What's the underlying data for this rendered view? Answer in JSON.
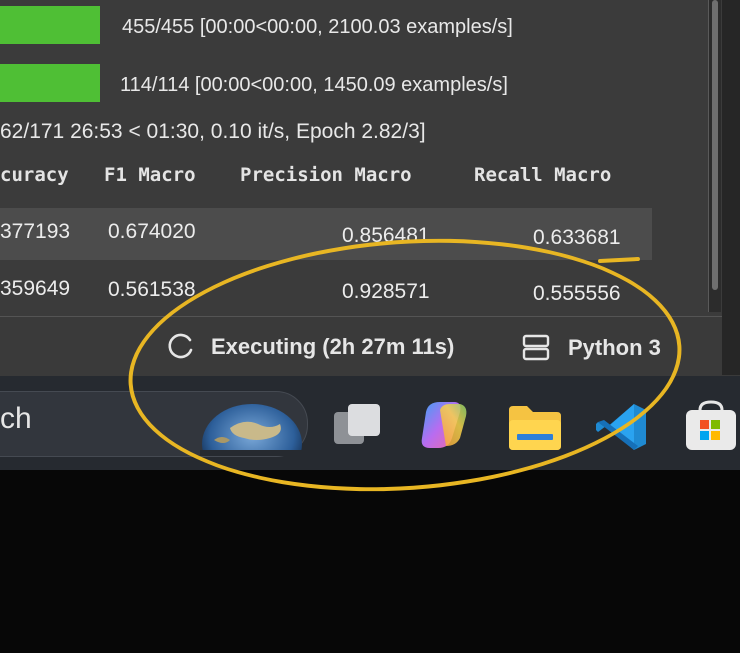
{
  "notebook": {
    "progress_rows": [
      {
        "text": "455/455  [00:00<00:00,  2100.03  examples/s]"
      },
      {
        "text": "114/114  [00:00<00:00,  1450.09  examples/s]"
      }
    ],
    "training_progress": "62/171 26:53 < 01:30, 0.10 it/s, Epoch 2.82/3]",
    "table": {
      "columns": [
        "curacy",
        "F1 Macro",
        "Precision Macro",
        "Recall Macro"
      ],
      "rows": [
        [
          "377193",
          "0.674020",
          "0.856481",
          "0.633681"
        ],
        [
          "359649",
          "0.561538",
          "0.928571",
          "0.555556"
        ]
      ]
    }
  },
  "statusbar": {
    "executing_label": "Executing (2h 27m 11s)",
    "kernel_label": "Python 3",
    "spinner_icon": "loading-spinner-icon",
    "kernel_icon": "kernel-status-icon"
  },
  "taskbar": {
    "search_text": "ch",
    "apps": [
      {
        "name": "earth-widget-icon"
      },
      {
        "name": "task-view-icon"
      },
      {
        "name": "copilot-icon"
      },
      {
        "name": "file-explorer-icon"
      },
      {
        "name": "vscode-icon"
      },
      {
        "name": "microsoft-store-icon"
      }
    ]
  },
  "colors": {
    "progress_green": "#4fbf35",
    "annotation_yellow": "#e8b623",
    "notebook_bg": "#3b3b3b",
    "taskbar_bg": "#262a30"
  }
}
